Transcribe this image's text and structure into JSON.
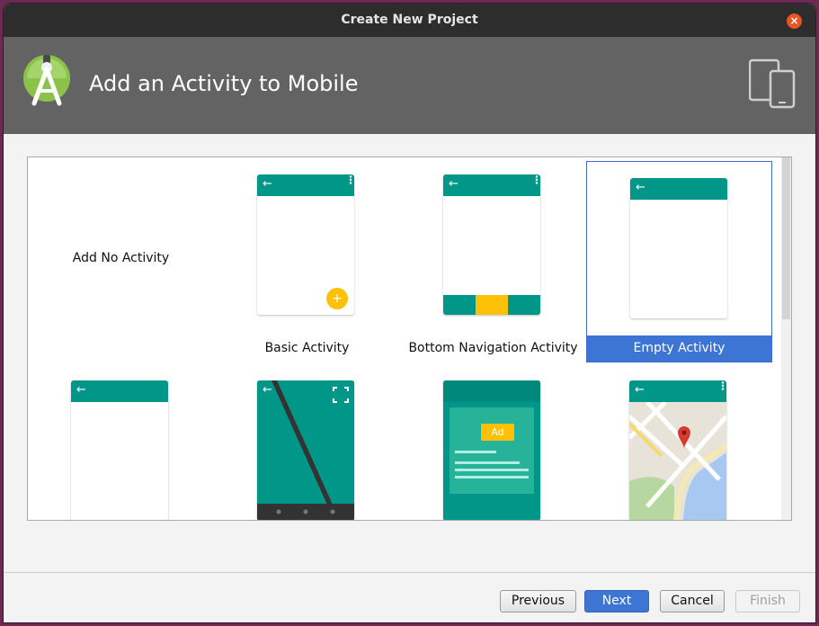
{
  "window": {
    "title": "Create New Project",
    "close_glyph": "×"
  },
  "banner": {
    "heading": "Add an Activity to Mobile",
    "logo_icon": "android-studio-icon",
    "devices_icon": "phone-tablet-icon"
  },
  "templates": [
    {
      "label": "Add No Activity"
    },
    {
      "label": "Basic Activity"
    },
    {
      "label": "Bottom Navigation Activity"
    },
    {
      "label": "Empty Activity",
      "selected": true
    },
    {
      "label": ""
    },
    {
      "label": ""
    },
    {
      "label": ""
    },
    {
      "label": ""
    }
  ],
  "icons": {
    "back": "←",
    "overflow": "⋮",
    "fab": "+",
    "ad_label": "Ad"
  },
  "buttons": {
    "previous": "Previous",
    "next": "Next",
    "cancel": "Cancel",
    "finish": "Finish"
  },
  "colors": {
    "teal": "#009688",
    "accent": "#ffc107",
    "selection": "#3d75d4"
  }
}
